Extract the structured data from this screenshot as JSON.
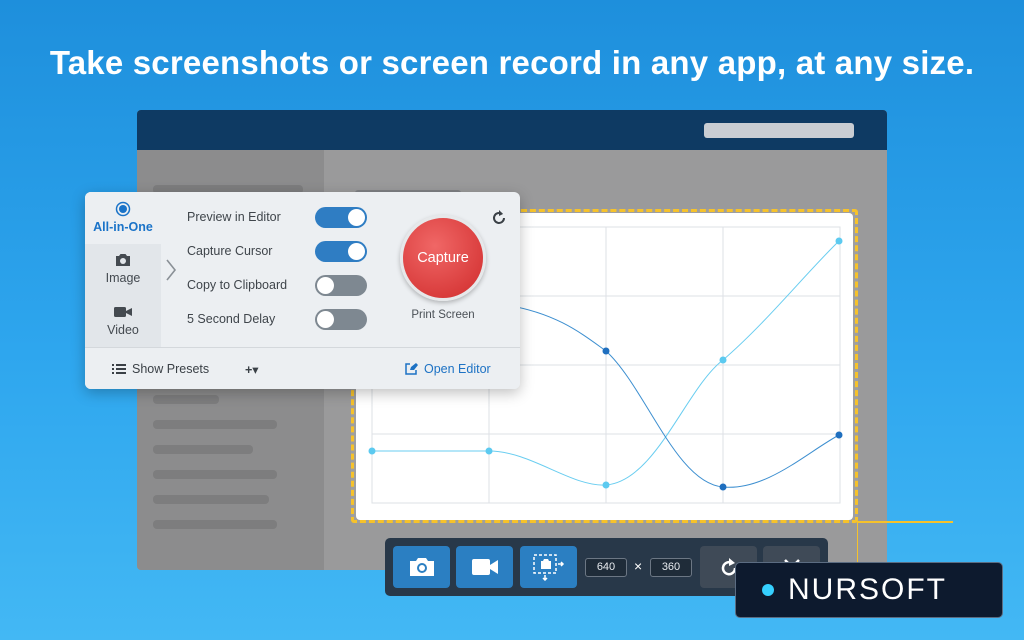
{
  "headline": "Take screenshots or screen record in any app, at any size.",
  "panel": {
    "modes": [
      {
        "label": "All-in-One",
        "icon": "radio-dot-icon",
        "active": true
      },
      {
        "label": "Image",
        "icon": "camera-icon",
        "active": false
      },
      {
        "label": "Video",
        "icon": "video-camera-icon",
        "active": false
      }
    ],
    "options": [
      {
        "label": "Preview in Editor",
        "on": true
      },
      {
        "label": "Capture Cursor",
        "on": true
      },
      {
        "label": "Copy to Clipboard",
        "on": false
      },
      {
        "label": "5 Second Delay",
        "on": false
      }
    ],
    "capture_label": "Capture",
    "capture_hint": "Print Screen",
    "show_presets": "Show Presets",
    "add_preset": "+▾",
    "open_editor": "Open Editor"
  },
  "toolbar": {
    "width_value": "640",
    "times": "×",
    "height_value": "360"
  },
  "watermark": "NURSOFT",
  "colors": {
    "accent": "#2b7fc2",
    "capture": "#d83a3a",
    "selection": "#f6c22b"
  }
}
